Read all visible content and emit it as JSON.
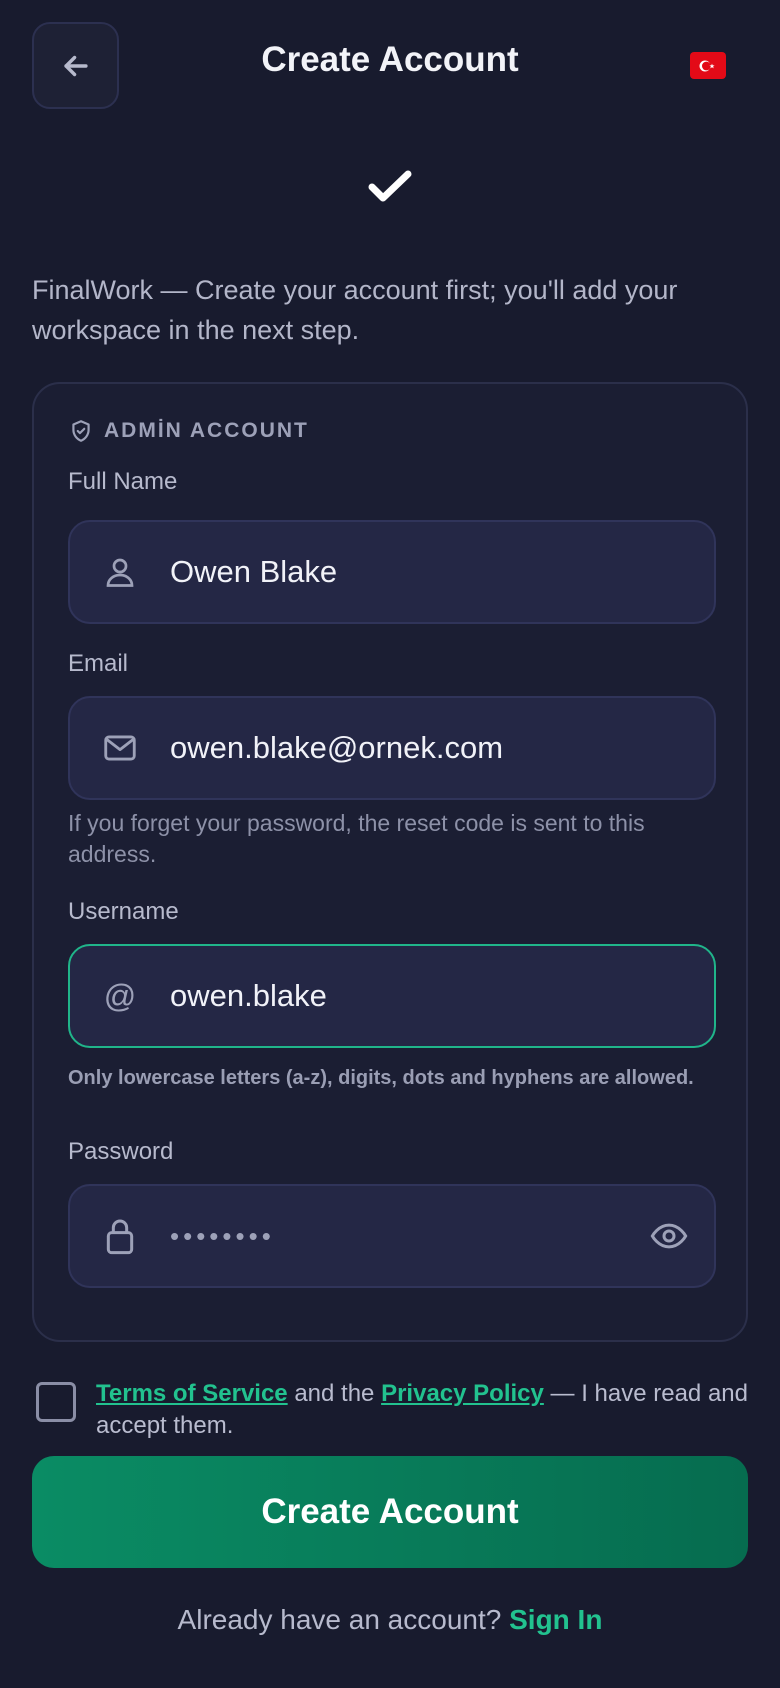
{
  "header": {
    "title": "Create Account",
    "back_icon": "arrow-left-icon",
    "flag_icon": "turkey-flag-icon"
  },
  "status_icon": "checkmark-icon",
  "intro": "FinalWork — Create your account first; you'll add your workspace in the next step.",
  "card": {
    "section_title": "ADMİN ACCOUNT",
    "section_icon": "shield-check-icon",
    "full_name": {
      "label": "Full Name",
      "value": "Owen Blake",
      "icon": "user-icon"
    },
    "email": {
      "label": "Email",
      "value": "owen.blake@ornek.com",
      "icon": "mail-icon",
      "help": "If you forget your password, the reset code is sent to this address."
    },
    "username": {
      "label": "Username",
      "value": "owen.blake",
      "icon": "at-icon",
      "help": "Only lowercase letters (a-z), digits, dots and hyphens are allowed."
    },
    "password": {
      "label": "Password",
      "value": "••••••••",
      "icon": "lock-icon",
      "toggle_icon": "eye-icon"
    }
  },
  "terms": {
    "checked": false,
    "tos_link": "Terms of Service",
    "and_text": " and the ",
    "privacy_link": "Privacy Policy",
    "suffix": " — I have read and accept them."
  },
  "cta": {
    "label": "Create Account"
  },
  "footer": {
    "prompt": "Already have an account? ",
    "link": "Sign In"
  },
  "colors": {
    "background": "#181b2e",
    "accent": "#22c28f",
    "cta": "#0a8c64"
  }
}
